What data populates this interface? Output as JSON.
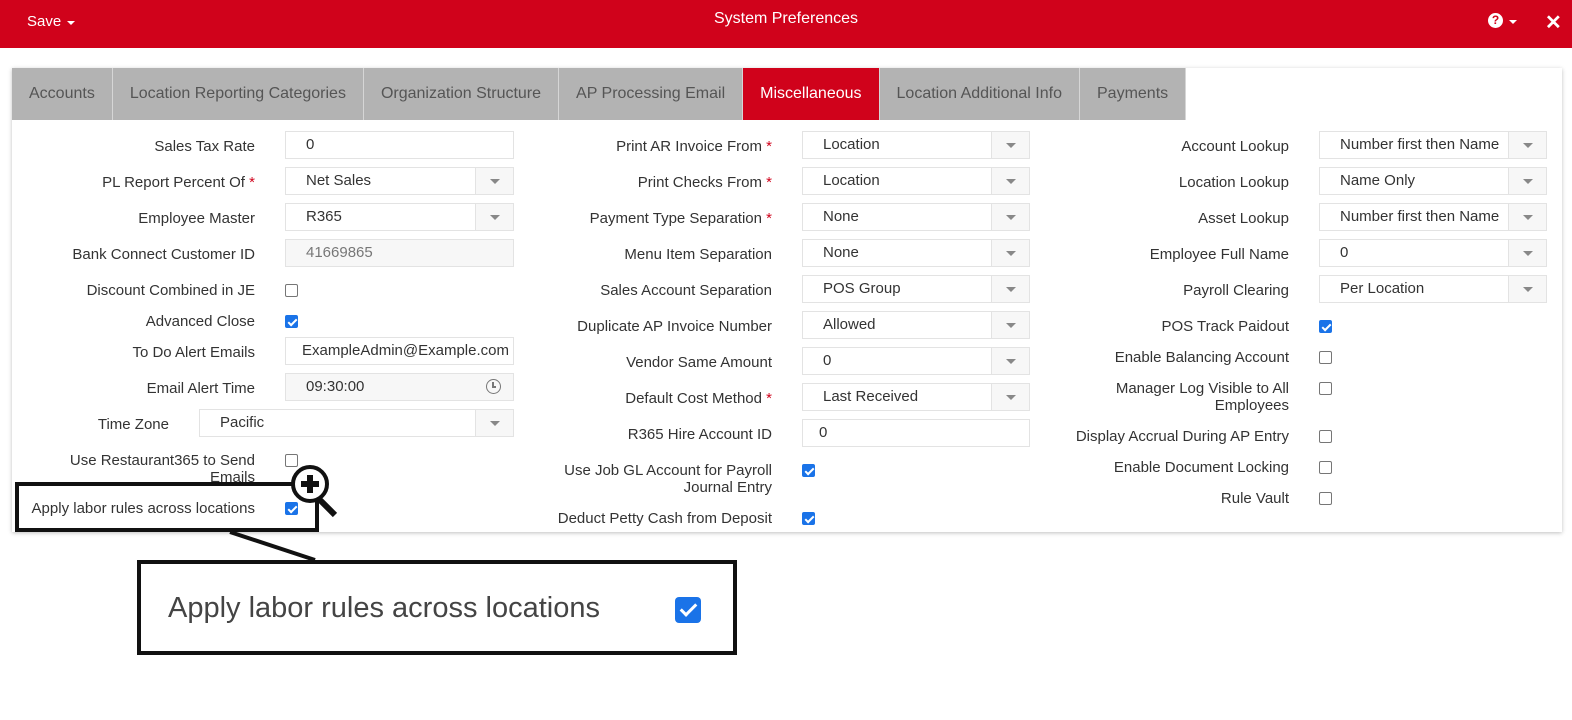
{
  "header": {
    "save_label": "Save",
    "title": "System Preferences",
    "help_icon": "question-circle-icon",
    "close_icon": "close-icon",
    "brand_color": "#d0021b"
  },
  "tabs": [
    {
      "label": "Accounts",
      "active": false
    },
    {
      "label": "Location Reporting Categories",
      "active": false
    },
    {
      "label": "Organization Structure",
      "active": false
    },
    {
      "label": "AP Processing Email",
      "active": false
    },
    {
      "label": "Miscellaneous",
      "active": true
    },
    {
      "label": "Location Additional Info",
      "active": false
    },
    {
      "label": "Payments",
      "active": false
    }
  ],
  "col1": {
    "sales_tax_rate": {
      "label": "Sales Tax Rate",
      "value": "0"
    },
    "pl_report_percent_of": {
      "label": "PL Report Percent Of",
      "required": "*",
      "value": "Net Sales"
    },
    "employee_master": {
      "label": "Employee Master",
      "value": "R365"
    },
    "bank_connect_customer_id": {
      "label": "Bank Connect Customer ID",
      "value": "41669865"
    },
    "discount_combined_in_je": {
      "label": "Discount Combined in JE",
      "checked": false
    },
    "advanced_close": {
      "label": "Advanced Close",
      "checked": true
    },
    "to_do_alert_emails": {
      "label": "To Do Alert Emails",
      "value": "ExampleAdmin@Example.com"
    },
    "email_alert_time": {
      "label": "Email Alert Time",
      "value": "09:30:00"
    },
    "time_zone": {
      "label": "Time Zone",
      "value": "Pacific"
    },
    "use_r365_send_emails": {
      "label": "Use Restaurant365 to Send Emails",
      "checked": false
    },
    "apply_labor_rules": {
      "label": "Apply labor rules across locations",
      "checked": true
    }
  },
  "col2": {
    "print_ar_invoice_from": {
      "label": "Print AR Invoice From",
      "required": "*",
      "value": "Location"
    },
    "print_checks_from": {
      "label": "Print Checks From",
      "required": "*",
      "value": "Location"
    },
    "payment_type_separation": {
      "label": "Payment Type Separation",
      "required": "*",
      "value": "None"
    },
    "menu_item_separation": {
      "label": "Menu Item Separation",
      "value": "None"
    },
    "sales_account_separation": {
      "label": "Sales Account Separation",
      "value": "POS Group"
    },
    "duplicate_ap_invoice_number": {
      "label": "Duplicate AP Invoice Number",
      "value": "Allowed"
    },
    "vendor_same_amount": {
      "label": "Vendor Same Amount",
      "value": "0"
    },
    "default_cost_method": {
      "label": "Default Cost Method",
      "required": "*",
      "value": "Last Received"
    },
    "r365_hire_account_id": {
      "label": "R365 Hire Account ID",
      "value": "0"
    },
    "use_job_gl_account": {
      "label": "Use Job GL Account for Payroll Journal Entry",
      "checked": true
    },
    "deduct_petty_cash": {
      "label": "Deduct Petty Cash from Deposit",
      "checked": true
    }
  },
  "col3": {
    "account_lookup": {
      "label": "Account Lookup",
      "value": "Number first then Name"
    },
    "location_lookup": {
      "label": "Location Lookup",
      "value": "Name Only"
    },
    "asset_lookup": {
      "label": "Asset Lookup",
      "value": "Number first then Name"
    },
    "employee_full_name": {
      "label": "Employee Full Name",
      "value": "0"
    },
    "payroll_clearing": {
      "label": "Payroll Clearing",
      "value": "Per Location"
    },
    "pos_track_paidout": {
      "label": "POS Track Paidout",
      "checked": true
    },
    "enable_balancing_account": {
      "label": "Enable Balancing Account",
      "checked": false
    },
    "manager_log_visible": {
      "label": "Manager Log Visible to All Employees",
      "checked": false
    },
    "display_accrual": {
      "label": "Display Accrual During AP Entry",
      "checked": false
    },
    "enable_document_locking": {
      "label": "Enable Document Locking",
      "checked": false
    },
    "rule_vault": {
      "label": "Rule Vault",
      "checked": false
    }
  },
  "callout": {
    "text": "Apply labor rules across locations",
    "checked": true,
    "icon": "zoom-in-icon"
  }
}
